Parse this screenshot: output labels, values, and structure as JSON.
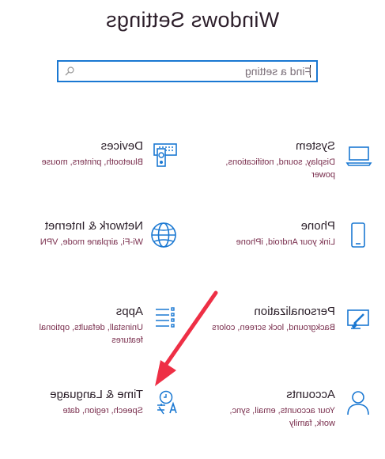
{
  "window": {
    "title": "Windows Settings"
  },
  "search": {
    "placeholder": "Find a setting"
  },
  "tiles": [
    {
      "name": "System",
      "desc": "Display, sound, notifications, power",
      "icon": "laptop-icon"
    },
    {
      "name": "Devices",
      "desc": "Bluetooth, printers, mouse",
      "icon": "keyboard-icon"
    },
    {
      "name": "Phone",
      "desc": "Link your Android, iPhone",
      "icon": "phone-icon"
    },
    {
      "name": "Network & Internet",
      "desc": "Wi-Fi, airplane mode, VPN",
      "icon": "globe-icon"
    },
    {
      "name": "Personalization",
      "desc": "Background, lock screen, colors",
      "icon": "paint-icon"
    },
    {
      "name": "Apps",
      "desc": "Uninstall, defaults, optional features",
      "icon": "apps-list-icon"
    },
    {
      "name": "Accounts",
      "desc": "Your accounts, email, sync, work, family",
      "icon": "person-icon"
    },
    {
      "name": "Time & Language",
      "desc": "Speech, region, date",
      "icon": "time-language-icon"
    }
  ],
  "colors": {
    "accent": "#1a78d2",
    "annotation_arrow": "#ee2f45",
    "description_text": "#7a2f4e"
  },
  "annotation": {
    "type": "arrow",
    "target": "Time & Language"
  }
}
